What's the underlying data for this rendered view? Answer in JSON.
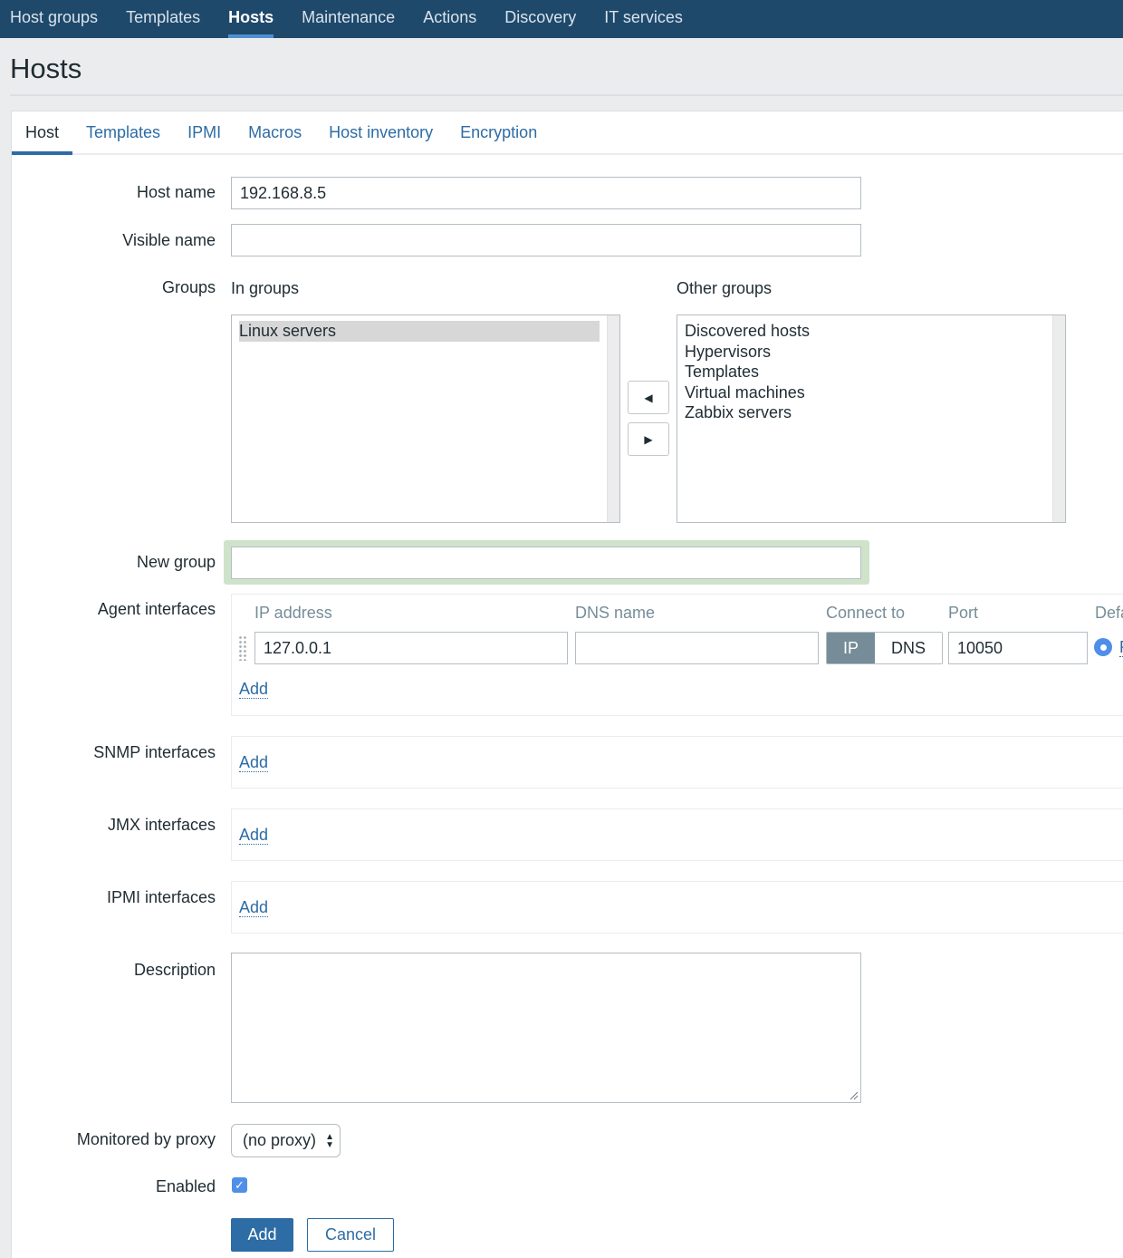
{
  "topnav": {
    "items": [
      {
        "label": "Host groups",
        "active": false
      },
      {
        "label": "Templates",
        "active": false
      },
      {
        "label": "Hosts",
        "active": true
      },
      {
        "label": "Maintenance",
        "active": false
      },
      {
        "label": "Actions",
        "active": false
      },
      {
        "label": "Discovery",
        "active": false
      },
      {
        "label": "IT services",
        "active": false
      }
    ]
  },
  "page": {
    "title": "Hosts"
  },
  "tabs": [
    {
      "label": "Host",
      "active": true
    },
    {
      "label": "Templates",
      "active": false
    },
    {
      "label": "IPMI",
      "active": false
    },
    {
      "label": "Macros",
      "active": false
    },
    {
      "label": "Host inventory",
      "active": false
    },
    {
      "label": "Encryption",
      "active": false
    }
  ],
  "form": {
    "host_name": {
      "label": "Host name",
      "value": "192.168.8.5"
    },
    "visible_name": {
      "label": "Visible name",
      "value": ""
    },
    "groups": {
      "label": "Groups",
      "in_groups_label": "In groups",
      "other_groups_label": "Other groups",
      "in_groups": [
        "Linux servers"
      ],
      "in_groups_selected": "Linux servers",
      "other_groups": [
        "Discovered hosts",
        "Hypervisors",
        "Templates",
        "Virtual machines",
        "Zabbix servers"
      ],
      "move_left_icon": "triangle-left-icon",
      "move_right_icon": "triangle-right-icon"
    },
    "new_group": {
      "label": "New group",
      "value": ""
    },
    "agent_interfaces": {
      "label": "Agent interfaces",
      "columns": {
        "ip": "IP address",
        "dns": "DNS name",
        "connect": "Connect to",
        "port": "Port",
        "default": "Default"
      },
      "row": {
        "ip": "127.0.0.1",
        "dns": "",
        "connect_options": [
          "IP",
          "DNS"
        ],
        "connect_selected": "IP",
        "port": "10050",
        "default_selected": true,
        "default_label": "Remove"
      },
      "add_label": "Add"
    },
    "snmp_interfaces": {
      "label": "SNMP interfaces",
      "add_label": "Add"
    },
    "jmx_interfaces": {
      "label": "JMX interfaces",
      "add_label": "Add"
    },
    "ipmi_interfaces": {
      "label": "IPMI interfaces",
      "add_label": "Add"
    },
    "description": {
      "label": "Description",
      "value": ""
    },
    "proxy": {
      "label": "Monitored by proxy",
      "selected": "(no proxy)"
    },
    "enabled": {
      "label": "Enabled",
      "checked": true
    },
    "buttons": {
      "add": "Add",
      "cancel": "Cancel"
    }
  },
  "colors": {
    "nav_bg": "#1f496b",
    "accent": "#2d6ca5",
    "active_underline": "#4f8fd0",
    "new_group_highlight": "#cfe3cb",
    "radio_checkbox": "#4f8fe8"
  }
}
